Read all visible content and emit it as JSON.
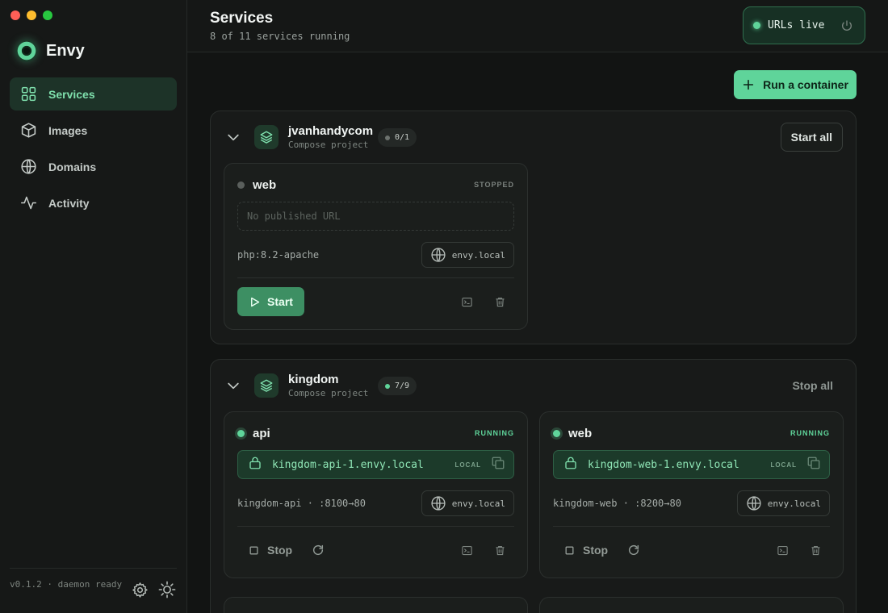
{
  "window": {
    "controls": [
      "close",
      "minimize",
      "zoom"
    ]
  },
  "brand": {
    "name": "Envy",
    "logo_icon": "eye-logo-icon"
  },
  "sidebar": {
    "items": [
      {
        "label": "Services",
        "icon": "grid-icon",
        "active": true
      },
      {
        "label": "Images",
        "icon": "cube-icon",
        "active": false
      },
      {
        "label": "Domains",
        "icon": "globe-icon",
        "active": false
      },
      {
        "label": "Activity",
        "icon": "activity-icon",
        "active": false
      }
    ],
    "footer": {
      "version_text": "v0.1.2 · daemon ready"
    }
  },
  "header": {
    "title": "Services",
    "subtitle": "8 of 11 services running",
    "urls_live_label": "URLs live"
  },
  "main": {
    "run_container_label": "Run a container",
    "projects": [
      {
        "name": "jvanhandycom",
        "subtitle": "Compose project",
        "count": "0/1",
        "action_label": "Start all",
        "services": [
          {
            "name": "web",
            "status": "STOPPED",
            "url_placeholder": "No published URL",
            "meta": "php:8.2-apache",
            "domain": "envy.local",
            "primary_action": "Start"
          }
        ]
      },
      {
        "name": "kingdom",
        "subtitle": "Compose project",
        "count": "7/9",
        "action_label": "Stop all",
        "services": [
          {
            "name": "api",
            "status": "RUNNING",
            "url": "kingdom-api-1.envy.local",
            "url_tag": "LOCAL",
            "meta": "kingdom-api · :8100→80",
            "domain": "envy.local",
            "primary_action": "Stop"
          },
          {
            "name": "web",
            "status": "RUNNING",
            "url": "kingdom-web-1.envy.local",
            "url_tag": "LOCAL",
            "meta": "kingdom-web · :8200→80",
            "domain": "envy.local",
            "primary_action": "Stop"
          }
        ]
      }
    ]
  },
  "colors": {
    "accent": "#5fd49a",
    "background": "#121413",
    "sidebar_active": "#1d3328",
    "stopped": "#5a5f5c"
  }
}
